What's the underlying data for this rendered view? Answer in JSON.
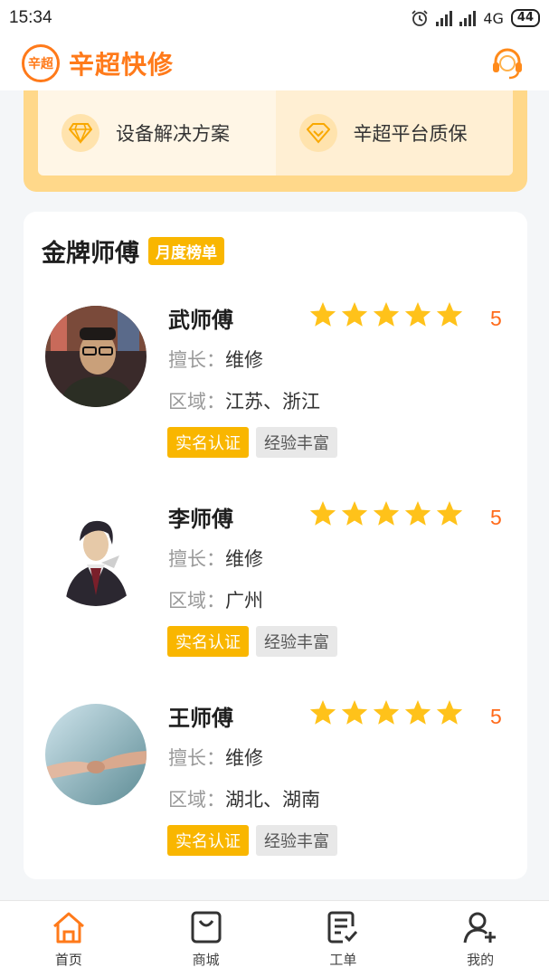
{
  "status_bar": {
    "time": "15:34",
    "network": "4G",
    "battery": "44"
  },
  "header": {
    "logo_text": "辛超",
    "title": "辛超快修"
  },
  "promo": {
    "items": [
      "设备解决方案",
      "辛超平台质保"
    ]
  },
  "ranking": {
    "title": "金牌师傅",
    "badge": "月度榜单",
    "specialty_label": "擅长：",
    "region_label": "区域：",
    "masters": [
      {
        "name": "武师傅",
        "rating": 5,
        "score": "5",
        "specialty": "维修",
        "region": "江苏、浙江",
        "tags": [
          "实名认证",
          "经验丰富"
        ]
      },
      {
        "name": "李师傅",
        "rating": 5,
        "score": "5",
        "specialty": "维修",
        "region": "广州",
        "tags": [
          "实名认证",
          "经验丰富"
        ]
      },
      {
        "name": "王师傅",
        "rating": 5,
        "score": "5",
        "specialty": "维修",
        "region": "湖北、湖南",
        "tags": [
          "实名认证",
          "经验丰富"
        ]
      }
    ]
  },
  "tabbar": {
    "items": [
      {
        "label": "首页",
        "icon": "home-icon",
        "active": true
      },
      {
        "label": "商城",
        "icon": "shop-bag-icon",
        "active": false
      },
      {
        "label": "工单",
        "icon": "work-order-icon",
        "active": false
      },
      {
        "label": "我的",
        "icon": "user-add-icon",
        "active": false
      }
    ]
  },
  "colors": {
    "accent": "#ff7a1a",
    "gold": "#f9b600",
    "score": "#ff6a1a"
  }
}
